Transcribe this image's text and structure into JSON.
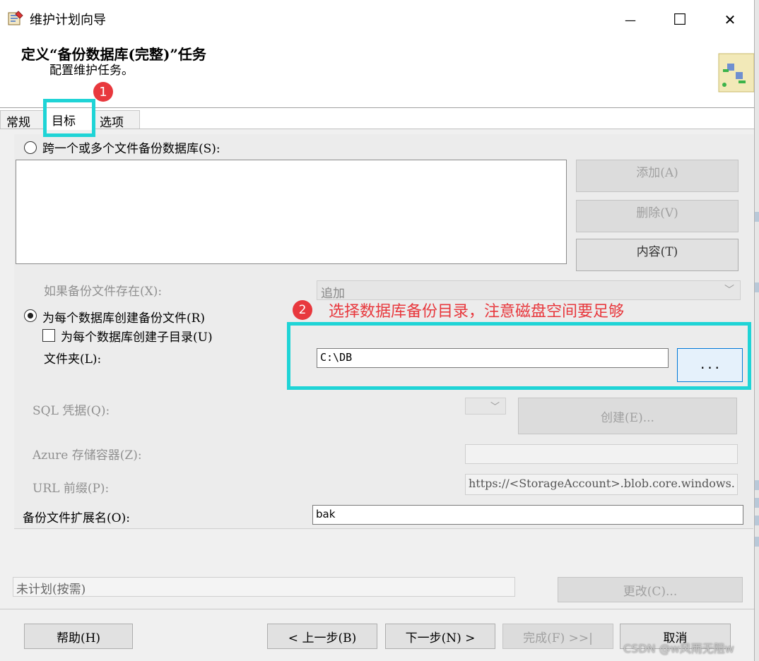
{
  "window": {
    "title": "维护计划向导",
    "minimize_glyph": "—",
    "maximize_glyph": "☐",
    "close_glyph": "✕",
    "app_icon": "wizard-app-icon"
  },
  "header": {
    "heading": "定义“备份数据库(完整)”任务",
    "subtitle": "配置维护任务。"
  },
  "tabs": [
    {
      "label": "常规"
    },
    {
      "label": "目标"
    },
    {
      "label": "选项"
    }
  ],
  "destination": {
    "span_label": "跨一个或多个文件备份数据库(S):",
    "add_label": "添加(A)",
    "remove_label": "删除(V)",
    "contents_label": "内容(T)",
    "exists_label": "如果备份文件存在(X):",
    "exists_value": "追加",
    "per_db_label": "为每个数据库创建备份文件(R)",
    "subdir_label": "为每个数据库创建子目录(U)",
    "folder_label": "文件夹(L):",
    "folder_value": "C:\\DB",
    "browse_label": "...",
    "sql_cred_label": "SQL 凭据(Q):",
    "create_label": "创建(E)...",
    "azure_label": "Azure 存储容器(Z):",
    "url_label": "URL 前缀(P):",
    "url_value": "https://<StorageAccount>.blob.core.windows.",
    "ext_label": "备份文件扩展名(O):",
    "ext_value": "bak"
  },
  "schedule": {
    "value": "未计划(按需)",
    "change_label": "更改(C)..."
  },
  "footer": {
    "help_label": "帮助(H)",
    "back_label": "< 上一步(B)",
    "next_label": "下一步(N) >",
    "finish_label": "完成(F) >>|",
    "cancel_label": "取消"
  },
  "annotations": {
    "badge1": "1",
    "badge2": "2",
    "note2": "选择数据库备份目录，注意磁盘空间要足够",
    "accent_color": "#1fd4d6",
    "badge_color": "#e8383d"
  },
  "watermark": "CSDN @w风雨无阻w"
}
